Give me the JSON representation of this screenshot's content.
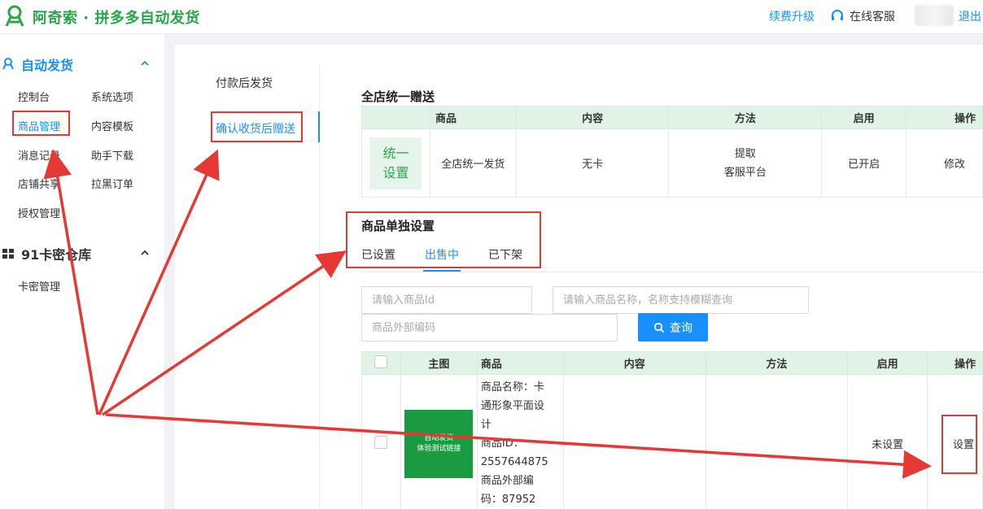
{
  "header": {
    "brand": "阿奇索 · 拼多多自动发货",
    "renew": "续费升级",
    "service": "在线客服",
    "logout": "退出"
  },
  "sidebar": {
    "section1": {
      "title": "自动发货",
      "items": [
        "控制台",
        "系统选项",
        "商品管理",
        "内容模板",
        "消息记录",
        "助手下载",
        "店铺共享",
        "拉黑订单",
        "授权管理"
      ]
    },
    "section2": {
      "title": "91卡密仓库",
      "items": [
        "卡密管理"
      ]
    }
  },
  "subnav": {
    "items": [
      "付款后发货",
      "确认收货后赠送"
    ]
  },
  "store_gift": {
    "title": "全店统一赠送",
    "headers": [
      "商品",
      "内容",
      "方法",
      "启用",
      "操作"
    ],
    "row": {
      "tag": [
        "统一",
        "设置"
      ],
      "product": "全店统一发货",
      "content": "无卡",
      "method": [
        "提取",
        "客服平台"
      ],
      "enabled": "已开启",
      "action": "修改"
    }
  },
  "product_settings": {
    "title": "商品单独设置",
    "tabs": [
      "已设置",
      "出售中",
      "已下架"
    ]
  },
  "search": {
    "id_placeholder": "请输入商品Id",
    "name_placeholder": "请输入商品名称，名称支持模糊查询",
    "code_placeholder": "商品外部编码",
    "button": "查询"
  },
  "product_table": {
    "headers": [
      "主图",
      "商品",
      "内容",
      "方法",
      "启用",
      "操作"
    ],
    "row": {
      "thumb_text": [
        "自动发货",
        "体验测试链接"
      ],
      "product_lines": [
        "商品名称：卡",
        "通形象平面设",
        "计",
        "商品ID：",
        "2557644875",
        "商品外部编",
        "码：87952"
      ],
      "enabled": "未设置",
      "action": "设置"
    }
  },
  "colors": {
    "brand_green": "#2aa54a",
    "accent_blue": "#1890ff",
    "annotation_red": "#e53935"
  }
}
